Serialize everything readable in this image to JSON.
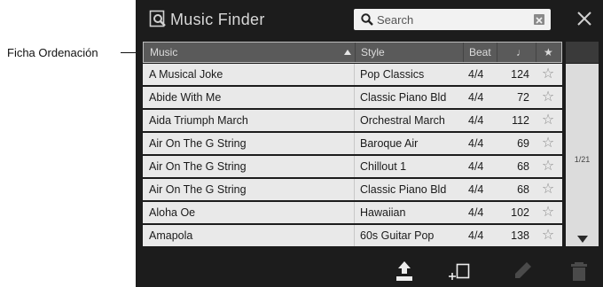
{
  "callout": {
    "label": "Ficha Ordenación"
  },
  "titlebar": {
    "title": "Music Finder",
    "title_icon": "music-finder-icon",
    "close_icon": "close-icon"
  },
  "search": {
    "placeholder": "Search",
    "value": "",
    "icon": "search-icon",
    "clear_icon": "clear-icon"
  },
  "columns": {
    "music": "Music",
    "style": "Style",
    "beat": "Beat",
    "tempo": "♩",
    "favorite": "★"
  },
  "sort": {
    "column": "music",
    "direction": "ascending",
    "icon": "sort-up-arrow-icon"
  },
  "rows": [
    {
      "music": "A Musical Joke",
      "style": "Pop Classics",
      "beat": "4/4",
      "tempo": "124",
      "favorite": "☆"
    },
    {
      "music": "Abide With Me",
      "style": "Classic Piano Bld",
      "beat": "4/4",
      "tempo": "72",
      "favorite": "☆"
    },
    {
      "music": "Aida Triumph March",
      "style": "Orchestral March",
      "beat": "4/4",
      "tempo": "112",
      "favorite": "☆"
    },
    {
      "music": "Air On The G String",
      "style": "Baroque Air",
      "beat": "4/4",
      "tempo": "69",
      "favorite": "☆"
    },
    {
      "music": "Air On The G String",
      "style": "Chillout 1",
      "beat": "4/4",
      "tempo": "68",
      "favorite": "☆"
    },
    {
      "music": "Air On The G String",
      "style": "Classic Piano Bld",
      "beat": "4/4",
      "tempo": "68",
      "favorite": "☆"
    },
    {
      "music": "Aloha Oe",
      "style": "Hawaiian",
      "beat": "4/4",
      "tempo": "102",
      "favorite": "☆"
    },
    {
      "music": "Amapola",
      "style": "60s Guitar Pop",
      "beat": "4/4",
      "tempo": "138",
      "favorite": "☆"
    }
  ],
  "pagination": {
    "page": "1/21",
    "down_icon": "scroll-down-arrow-icon"
  },
  "toolbar": {
    "icons": [
      "load-icon",
      "add-new-icon",
      "edit-icon",
      "delete-icon"
    ]
  },
  "colors": {
    "screen_bg": "#1c1c1c",
    "header_bg": "#5a5a5a",
    "row_bg": "#e9e9e9",
    "scroll_bg": "#dcdcdc"
  }
}
